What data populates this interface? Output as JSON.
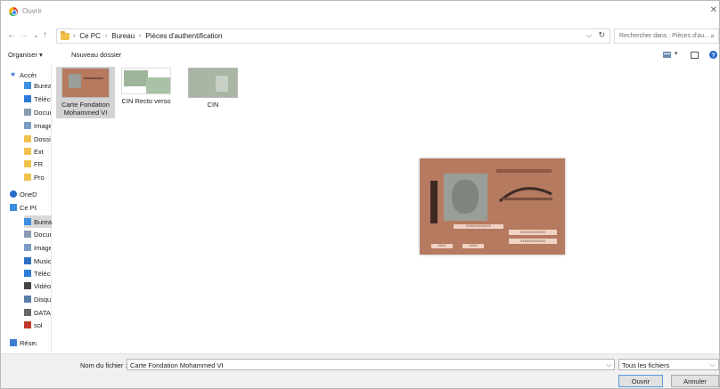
{
  "window": {
    "title": "Ouvrir",
    "close": "✕"
  },
  "nav": {
    "back": "←",
    "forward": "→",
    "recent": "⌄",
    "up": "↑",
    "breadcrumbs": [
      "Ce PC",
      "Bureau",
      "Pièces d'authentification"
    ],
    "separator": "›",
    "search_placeholder": "Rechercher dans : Pièces d'au..."
  },
  "toolbar": {
    "organize": "Organiser ▾",
    "new_folder": "Nouveau dossier"
  },
  "sidebar": {
    "items": [
      {
        "label": "Accès rapide",
        "icon": "star-icon",
        "color": "#3b7bd4"
      },
      {
        "label": "Bureau",
        "icon": "desktop-icon",
        "color": "#3b8ee0"
      },
      {
        "label": "Téléchargements",
        "icon": "download-icon",
        "color": "#2e7bd6"
      },
      {
        "label": "Documents",
        "icon": "document-icon",
        "color": "#8a9bb3"
      },
      {
        "label": "Images",
        "icon": "image-icon",
        "color": "#7a9cc4"
      },
      {
        "label": "Dossier",
        "icon": "folder-icon",
        "color": "#f0c24c"
      },
      {
        "label": "Ext",
        "icon": "folder-icon",
        "color": "#f0c24c"
      },
      {
        "label": "FR",
        "icon": "folder-icon",
        "color": "#f0c24c"
      },
      {
        "label": "Pro",
        "icon": "folder-icon",
        "color": "#f0c24c"
      },
      {
        "label": "OneDrive",
        "icon": "cloud-icon",
        "color": "#2a6ac9"
      },
      {
        "label": "Ce PC",
        "icon": "computer-icon",
        "color": "#3b8ee0"
      },
      {
        "label": "Bureau",
        "icon": "desktop-icon",
        "color": "#3b8ee0"
      },
      {
        "label": "Documents",
        "icon": "document-icon",
        "color": "#8a9bb3"
      },
      {
        "label": "Images",
        "icon": "image-icon",
        "color": "#7a9cc4"
      },
      {
        "label": "Musique",
        "icon": "music-icon",
        "color": "#2e6fc2"
      },
      {
        "label": "Téléchargements",
        "icon": "download-icon",
        "color": "#2e7bd6"
      },
      {
        "label": "Vidéos",
        "icon": "video-icon",
        "color": "#444"
      },
      {
        "label": "Disque local",
        "icon": "drive-icon",
        "color": "#5a7fa8"
      },
      {
        "label": "DATA",
        "icon": "drive-icon",
        "color": "#666"
      },
      {
        "label": "sol",
        "icon": "network-drive-icon",
        "color": "#c0392b"
      },
      {
        "label": "Réseau",
        "icon": "network-icon",
        "color": "#3b7bd4"
      }
    ]
  },
  "files": [
    {
      "name": "Carte Fondation Mohammed VI",
      "selected": true
    },
    {
      "name": "CIN Recto verso",
      "selected": false
    },
    {
      "name": "CIN",
      "selected": false
    }
  ],
  "preview": {
    "text_lines": [
      "XXXXXXXXXXXX",
      "XXXXXXXXXXXX",
      "XXXXXXXXXXXX",
      "XXXX",
      "XXXX"
    ]
  },
  "footer": {
    "filename_label": "Nom du fichier :",
    "filename_value": "Carte Fondation Mohammed VI",
    "filter_value": "Tous les fichiers",
    "open_button": "Ouvrir",
    "cancel_button": "Annuler"
  },
  "colors": {
    "card": "#b57a5f",
    "selection": "#d3d3d3",
    "accent": "#2e7bd6"
  }
}
